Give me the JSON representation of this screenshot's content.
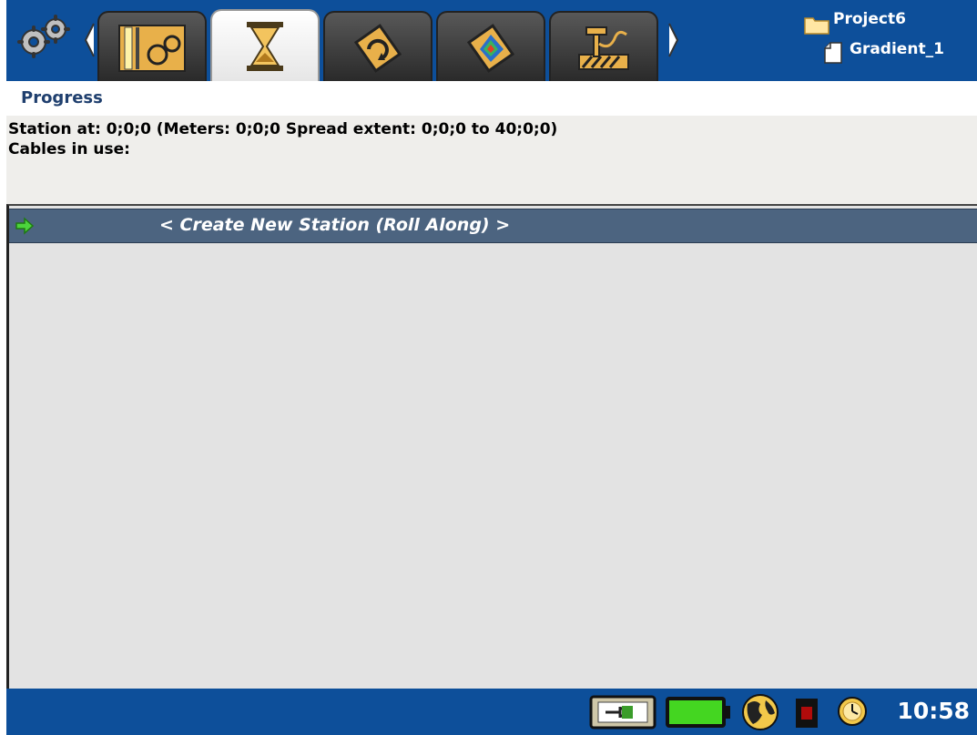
{
  "header": {
    "project_name": "Project6",
    "file_name": "Gradient_1",
    "tabs": [
      {
        "icon": "spread-settings-icon",
        "active": false
      },
      {
        "icon": "hourglass-icon",
        "active": true
      },
      {
        "icon": "roll-along-icon",
        "active": false
      },
      {
        "icon": "map-view-icon",
        "active": false
      },
      {
        "icon": "electrode-icon",
        "active": false
      }
    ]
  },
  "progress": {
    "title": "Progress",
    "station_line": "Station at: 0;0;0 (Meters: 0;0;0 Spread extent: 0;0;0 to 40;0;0)",
    "cables_line": "Cables in use:"
  },
  "list": {
    "rows": [
      {
        "label": "< Create New Station (Roll Along) >",
        "selected": true
      }
    ]
  },
  "statusbar": {
    "time": "10:58",
    "icons": [
      "power-plug-icon",
      "battery-icon",
      "gps-globe-icon",
      "record-indicator-icon",
      "clock-icon"
    ]
  },
  "colors": {
    "top_bar": "#0d4f9a",
    "selected_row": "#4c6480",
    "list_background": "#e3e3e3",
    "info_background": "#efeeeb"
  }
}
